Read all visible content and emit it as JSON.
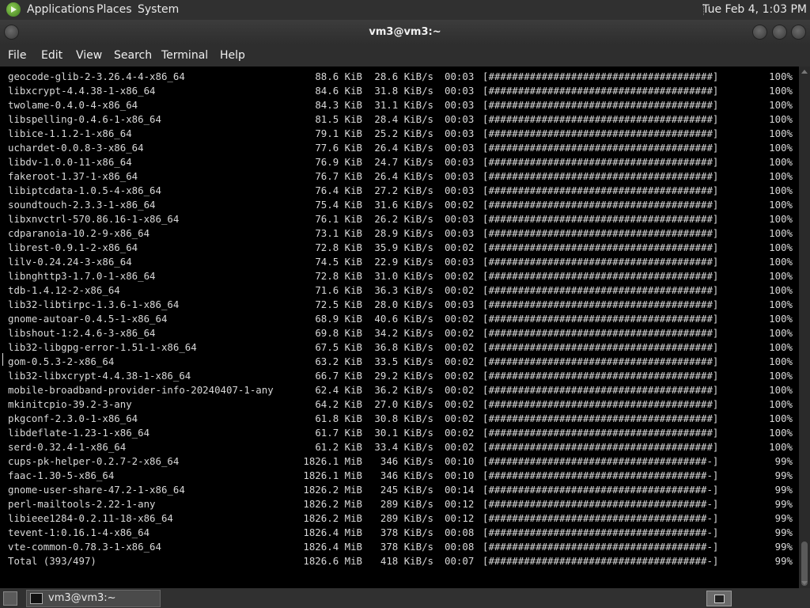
{
  "top_panel": {
    "menus": [
      "Applications",
      "Places",
      "System"
    ],
    "clock": "Tue Feb  4,  1:03 PM"
  },
  "window": {
    "title": "vm3@vm3:~"
  },
  "menubar": [
    "File",
    "Edit",
    "View",
    "Search",
    "Terminal",
    "Help"
  ],
  "terminal_lines": [
    {
      "name": "geocode-glib-2-3.26.4-4-x86_64",
      "size": "88.6 KiB",
      "speed": "28.6 KiB/s",
      "time": "00:03",
      "bar": "[######################################]",
      "pct": "100%"
    },
    {
      "name": "libxcrypt-4.4.38-1-x86_64",
      "size": "84.6 KiB",
      "speed": "31.8 KiB/s",
      "time": "00:03",
      "bar": "[######################################]",
      "pct": "100%"
    },
    {
      "name": "twolame-0.4.0-4-x86_64",
      "size": "84.3 KiB",
      "speed": "31.1 KiB/s",
      "time": "00:03",
      "bar": "[######################################]",
      "pct": "100%"
    },
    {
      "name": "libspelling-0.4.6-1-x86_64",
      "size": "81.5 KiB",
      "speed": "28.4 KiB/s",
      "time": "00:03",
      "bar": "[######################################]",
      "pct": "100%"
    },
    {
      "name": "libice-1.1.2-1-x86_64",
      "size": "79.1 KiB",
      "speed": "25.2 KiB/s",
      "time": "00:03",
      "bar": "[######################################]",
      "pct": "100%"
    },
    {
      "name": "uchardet-0.0.8-3-x86_64",
      "size": "77.6 KiB",
      "speed": "26.4 KiB/s",
      "time": "00:03",
      "bar": "[######################################]",
      "pct": "100%"
    },
    {
      "name": "libdv-1.0.0-11-x86_64",
      "size": "76.9 KiB",
      "speed": "24.7 KiB/s",
      "time": "00:03",
      "bar": "[######################################]",
      "pct": "100%"
    },
    {
      "name": "fakeroot-1.37-1-x86_64",
      "size": "76.7 KiB",
      "speed": "26.4 KiB/s",
      "time": "00:03",
      "bar": "[######################################]",
      "pct": "100%"
    },
    {
      "name": "libiptcdata-1.0.5-4-x86_64",
      "size": "76.4 KiB",
      "speed": "27.2 KiB/s",
      "time": "00:03",
      "bar": "[######################################]",
      "pct": "100%"
    },
    {
      "name": "soundtouch-2.3.3-1-x86_64",
      "size": "75.4 KiB",
      "speed": "31.6 KiB/s",
      "time": "00:02",
      "bar": "[######################################]",
      "pct": "100%"
    },
    {
      "name": "libxnvctrl-570.86.16-1-x86_64",
      "size": "76.1 KiB",
      "speed": "26.2 KiB/s",
      "time": "00:03",
      "bar": "[######################################]",
      "pct": "100%"
    },
    {
      "name": "cdparanoia-10.2-9-x86_64",
      "size": "73.1 KiB",
      "speed": "28.9 KiB/s",
      "time": "00:03",
      "bar": "[######################################]",
      "pct": "100%"
    },
    {
      "name": "librest-0.9.1-2-x86_64",
      "size": "72.8 KiB",
      "speed": "35.9 KiB/s",
      "time": "00:02",
      "bar": "[######################################]",
      "pct": "100%"
    },
    {
      "name": "lilv-0.24.24-3-x86_64",
      "size": "74.5 KiB",
      "speed": "22.9 KiB/s",
      "time": "00:03",
      "bar": "[######################################]",
      "pct": "100%"
    },
    {
      "name": "libnghttp3-1.7.0-1-x86_64",
      "size": "72.8 KiB",
      "speed": "31.0 KiB/s",
      "time": "00:02",
      "bar": "[######################################]",
      "pct": "100%"
    },
    {
      "name": "tdb-1.4.12-2-x86_64",
      "size": "71.6 KiB",
      "speed": "36.3 KiB/s",
      "time": "00:02",
      "bar": "[######################################]",
      "pct": "100%"
    },
    {
      "name": "lib32-libtirpc-1.3.6-1-x86_64",
      "size": "72.5 KiB",
      "speed": "28.0 KiB/s",
      "time": "00:03",
      "bar": "[######################################]",
      "pct": "100%"
    },
    {
      "name": "gnome-autoar-0.4.5-1-x86_64",
      "size": "68.9 KiB",
      "speed": "40.6 KiB/s",
      "time": "00:02",
      "bar": "[######################################]",
      "pct": "100%"
    },
    {
      "name": "libshout-1:2.4.6-3-x86_64",
      "size": "69.8 KiB",
      "speed": "34.2 KiB/s",
      "time": "00:02",
      "bar": "[######################################]",
      "pct": "100%"
    },
    {
      "name": "lib32-libgpg-error-1.51-1-x86_64",
      "size": "67.5 KiB",
      "speed": "36.8 KiB/s",
      "time": "00:02",
      "bar": "[######################################]",
      "pct": "100%"
    },
    {
      "name": "gom-0.5.3-2-x86_64",
      "size": "63.2 KiB",
      "speed": "33.5 KiB/s",
      "time": "00:02",
      "bar": "[######################################]",
      "pct": "100%"
    },
    {
      "name": "lib32-libxcrypt-4.4.38-1-x86_64",
      "size": "66.7 KiB",
      "speed": "29.2 KiB/s",
      "time": "00:02",
      "bar": "[######################################]",
      "pct": "100%"
    },
    {
      "name": "mobile-broadband-provider-info-20240407-1-any",
      "size": "62.4 KiB",
      "speed": "36.2 KiB/s",
      "time": "00:02",
      "bar": "[######################################]",
      "pct": "100%"
    },
    {
      "name": "mkinitcpio-39.2-3-any",
      "size": "64.2 KiB",
      "speed": "27.0 KiB/s",
      "time": "00:02",
      "bar": "[######################################]",
      "pct": "100%"
    },
    {
      "name": "pkgconf-2.3.0-1-x86_64",
      "size": "61.8 KiB",
      "speed": "30.8 KiB/s",
      "time": "00:02",
      "bar": "[######################################]",
      "pct": "100%"
    },
    {
      "name": "libdeflate-1.23-1-x86_64",
      "size": "61.7 KiB",
      "speed": "30.1 KiB/s",
      "time": "00:02",
      "bar": "[######################################]",
      "pct": "100%"
    },
    {
      "name": "serd-0.32.4-1-x86_64",
      "size": "61.2 KiB",
      "speed": "33.4 KiB/s",
      "time": "00:02",
      "bar": "[######################################]",
      "pct": "100%"
    },
    {
      "name": "cups-pk-helper-0.2.7-2-x86_64",
      "size": "1826.1 MiB",
      "speed": "346 KiB/s",
      "time": "00:10",
      "bar": "[#####################################-]",
      "pct": "99%"
    },
    {
      "name": "faac-1.30-5-x86_64",
      "size": "1826.1 MiB",
      "speed": "346 KiB/s",
      "time": "00:10",
      "bar": "[#####################################-]",
      "pct": "99%"
    },
    {
      "name": "gnome-user-share-47.2-1-x86_64",
      "size": "1826.2 MiB",
      "speed": "245 KiB/s",
      "time": "00:14",
      "bar": "[#####################################-]",
      "pct": "99%"
    },
    {
      "name": "perl-mailtools-2.22-1-any",
      "size": "1826.2 MiB",
      "speed": "289 KiB/s",
      "time": "00:12",
      "bar": "[#####################################-]",
      "pct": "99%"
    },
    {
      "name": "libieee1284-0.2.11-18-x86_64",
      "size": "1826.2 MiB",
      "speed": "289 KiB/s",
      "time": "00:12",
      "bar": "[#####################################-]",
      "pct": "99%"
    },
    {
      "name": "tevent-1:0.16.1-4-x86_64",
      "size": "1826.4 MiB",
      "speed": "378 KiB/s",
      "time": "00:08",
      "bar": "[#####################################-]",
      "pct": "99%"
    },
    {
      "name": "vte-common-0.78.3-1-x86_64",
      "size": "1826.4 MiB",
      "speed": "378 KiB/s",
      "time": "00:08",
      "bar": "[#####################################-]",
      "pct": "99%"
    },
    {
      "name": "Total (393/497)",
      "size": "1826.6 MiB",
      "speed": "418 KiB/s",
      "time": "00:07",
      "bar": "[#####################################-]",
      "pct": "99%"
    }
  ],
  "taskbar": {
    "task_label": "vm3@vm3:~"
  },
  "colors": {
    "terminal_bg": "#000000",
    "terminal_fg": "#d8d8d8",
    "panel_bg": "#303030"
  }
}
